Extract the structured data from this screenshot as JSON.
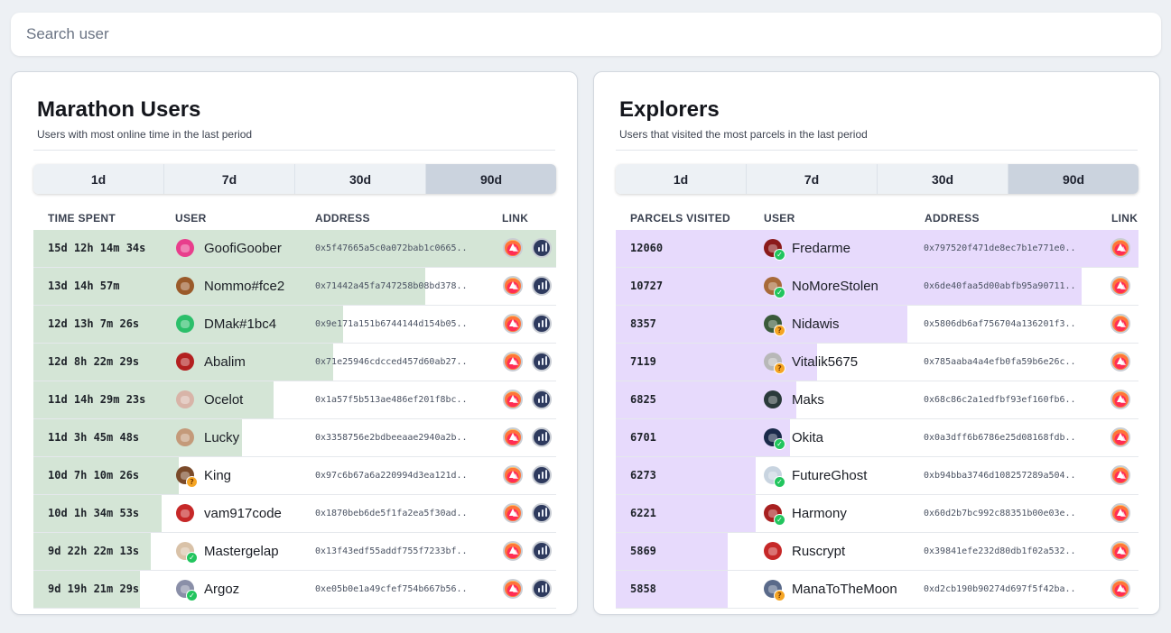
{
  "search": {
    "placeholder": "Search user"
  },
  "marathon": {
    "title": "Marathon Users",
    "subtitle": "Users with most online time in the last period",
    "tabs": [
      "1d",
      "7d",
      "30d",
      "90d"
    ],
    "active_tab": "90d",
    "columns": {
      "value": "TIME SPENT",
      "user": "USER",
      "address": "ADDRESS",
      "link": "LINK"
    },
    "bar_color": "#d4e5d6",
    "rows": [
      {
        "value": "15d 12h 14m 34s",
        "bar_fraction": 1.0,
        "user": "GoofiGoober",
        "address": "0x5f47665a5c0a072bab1c0665..",
        "badge": "none",
        "avatar_color": "#e83e8c"
      },
      {
        "value": "13d 14h 57m",
        "bar_fraction": 0.75,
        "user": "Nommo#fce2",
        "address": "0x71442a45fa747258b08bd378..",
        "badge": "none",
        "avatar_color": "#9a5a2a"
      },
      {
        "value": "12d 13h 7m 26s",
        "bar_fraction": 0.593,
        "user": "DMak#1bc4",
        "address": "0x9e171a151b6744144d154b05..",
        "badge": "none",
        "avatar_color": "#2bbf6a"
      },
      {
        "value": "12d 8h 22m 29s",
        "bar_fraction": 0.573,
        "user": "Abalim",
        "address": "0x71e25946cdcced457d60ab27..",
        "badge": "none",
        "avatar_color": "#b32020"
      },
      {
        "value": "11d 14h 29m 23s",
        "bar_fraction": 0.459,
        "user": "Ocelot",
        "address": "0x1a57f5b513ae486ef201f8bc..",
        "badge": "none",
        "avatar_color": "#d8b4a8"
      },
      {
        "value": "11d 3h 45m 48s",
        "bar_fraction": 0.399,
        "user": "Lucky",
        "address": "0x3358756e2bdbeeaae2940a2b..",
        "badge": "none",
        "avatar_color": "#c49a7a"
      },
      {
        "value": "10d 7h 10m 26s",
        "bar_fraction": 0.278,
        "user": "King",
        "address": "0x97c6b67a6a220994d3ea121d..",
        "badge": "unknown",
        "avatar_color": "#7a4a2a"
      },
      {
        "value": "10d 1h 34m 53s",
        "bar_fraction": 0.245,
        "user": "vam917code",
        "address": "0x1870beb6de5f1fa2ea5f30ad..",
        "badge": "none",
        "avatar_color": "#c62828"
      },
      {
        "value": "9d 22h 22m 13s",
        "bar_fraction": 0.225,
        "user": "Mastergelap",
        "address": "0x13f43edf55addf755f7233bf..",
        "badge": "verified",
        "avatar_color": "#d9c2a8"
      },
      {
        "value": "9d 19h 21m 29s",
        "bar_fraction": 0.203,
        "user": "Argoz",
        "address": "0xe05b0e1a49cfef754b667b56..",
        "badge": "verified",
        "avatar_color": "#8a8fa8"
      }
    ]
  },
  "explorers": {
    "title": "Explorers",
    "subtitle": "Users that visited the most parcels in the last period",
    "tabs": [
      "1d",
      "7d",
      "30d",
      "90d"
    ],
    "active_tab": "90d",
    "columns": {
      "value": "PARCELS VISITED",
      "user": "USER",
      "address": "ADDRESS",
      "link": "LINK"
    },
    "bar_color": "#e7dafc",
    "rows": [
      {
        "value": "12060",
        "bar_fraction": 1.0,
        "user": "Fredarme",
        "address": "0x797520f471de8ec7b1e771e0..",
        "badge": "verified",
        "avatar_color": "#8b1a1a"
      },
      {
        "value": "10727",
        "bar_fraction": 0.891,
        "user": "NoMoreStolen",
        "address": "0x6de40faa5d00abfb95a90711..",
        "badge": "verified",
        "avatar_color": "#a86a3a"
      },
      {
        "value": "8357",
        "bar_fraction": 0.558,
        "user": "Nidawis",
        "address": "0x5806db6af756704a136201f3..",
        "badge": "unknown",
        "avatar_color": "#3a5a3a"
      },
      {
        "value": "7119",
        "bar_fraction": 0.386,
        "user": "Vitalik5675",
        "address": "0x785aaba4a4efb0fa59b6e26c..",
        "badge": "unknown",
        "avatar_color": "#b8b8b8"
      },
      {
        "value": "6825",
        "bar_fraction": 0.345,
        "user": "Maks",
        "address": "0x68c86c2a1edfbf93ef160fb6..",
        "badge": "none",
        "avatar_color": "#2a3a3a"
      },
      {
        "value": "6701",
        "bar_fraction": 0.333,
        "user": "Okita",
        "address": "0x0a3dff6b6786e25d08168fdb..",
        "badge": "verified",
        "avatar_color": "#1a2a4a"
      },
      {
        "value": "6273",
        "bar_fraction": 0.268,
        "user": "FutureGhost",
        "address": "0xb94bba3746d108257289a504..",
        "badge": "verified",
        "avatar_color": "#c8d4e0"
      },
      {
        "value": "6221",
        "bar_fraction": 0.268,
        "user": "Harmony",
        "address": "0x60d2b7bc992c88351b00e03e..",
        "badge": "verified",
        "avatar_color": "#a82020"
      },
      {
        "value": "5869",
        "bar_fraction": 0.214,
        "user": "Ruscrypt",
        "address": "0x39841efe232d80db1f02a532..",
        "badge": "none",
        "avatar_color": "#c62828"
      },
      {
        "value": "5858",
        "bar_fraction": 0.214,
        "user": "ManaToTheMoon",
        "address": "0xd2cb190b90274d697f5f42ba..",
        "badge": "unknown",
        "avatar_color": "#5a6a8a"
      }
    ]
  },
  "icons": {
    "link_decentraland": "decentraland-logo-icon",
    "link_stats": "dcl-stats-icon",
    "badge_verified": "verified-check-icon",
    "badge_unknown": "question-mark-icon"
  }
}
